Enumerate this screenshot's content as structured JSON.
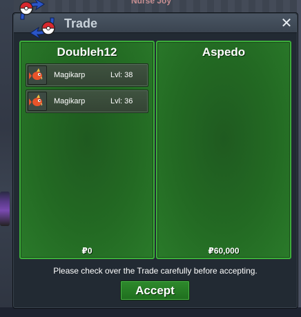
{
  "background": {
    "top_name": "Nurse Joy"
  },
  "window": {
    "title": "Trade",
    "close_label": "✕"
  },
  "left_panel": {
    "player_name": "Doubleh12",
    "pokemon": [
      {
        "name": "Magikarp",
        "level": "Lvl: 38",
        "icon": "magikarp-icon"
      },
      {
        "name": "Magikarp",
        "level": "Lvl: 36",
        "icon": "magikarp-icon"
      }
    ],
    "money": "₽0"
  },
  "right_panel": {
    "player_name": "Aspedo",
    "pokemon": [],
    "money": "₽60,000"
  },
  "notice": "Please check over the Trade carefully before accepting.",
  "accept_label": "Accept",
  "colors": {
    "panel_green": "#236a23",
    "panel_border": "#3cae3a",
    "accept_green": "#2e8a2c",
    "window_bg": "#222a33",
    "logo_red": "#d8282e",
    "logo_blue": "#2a55c8"
  }
}
